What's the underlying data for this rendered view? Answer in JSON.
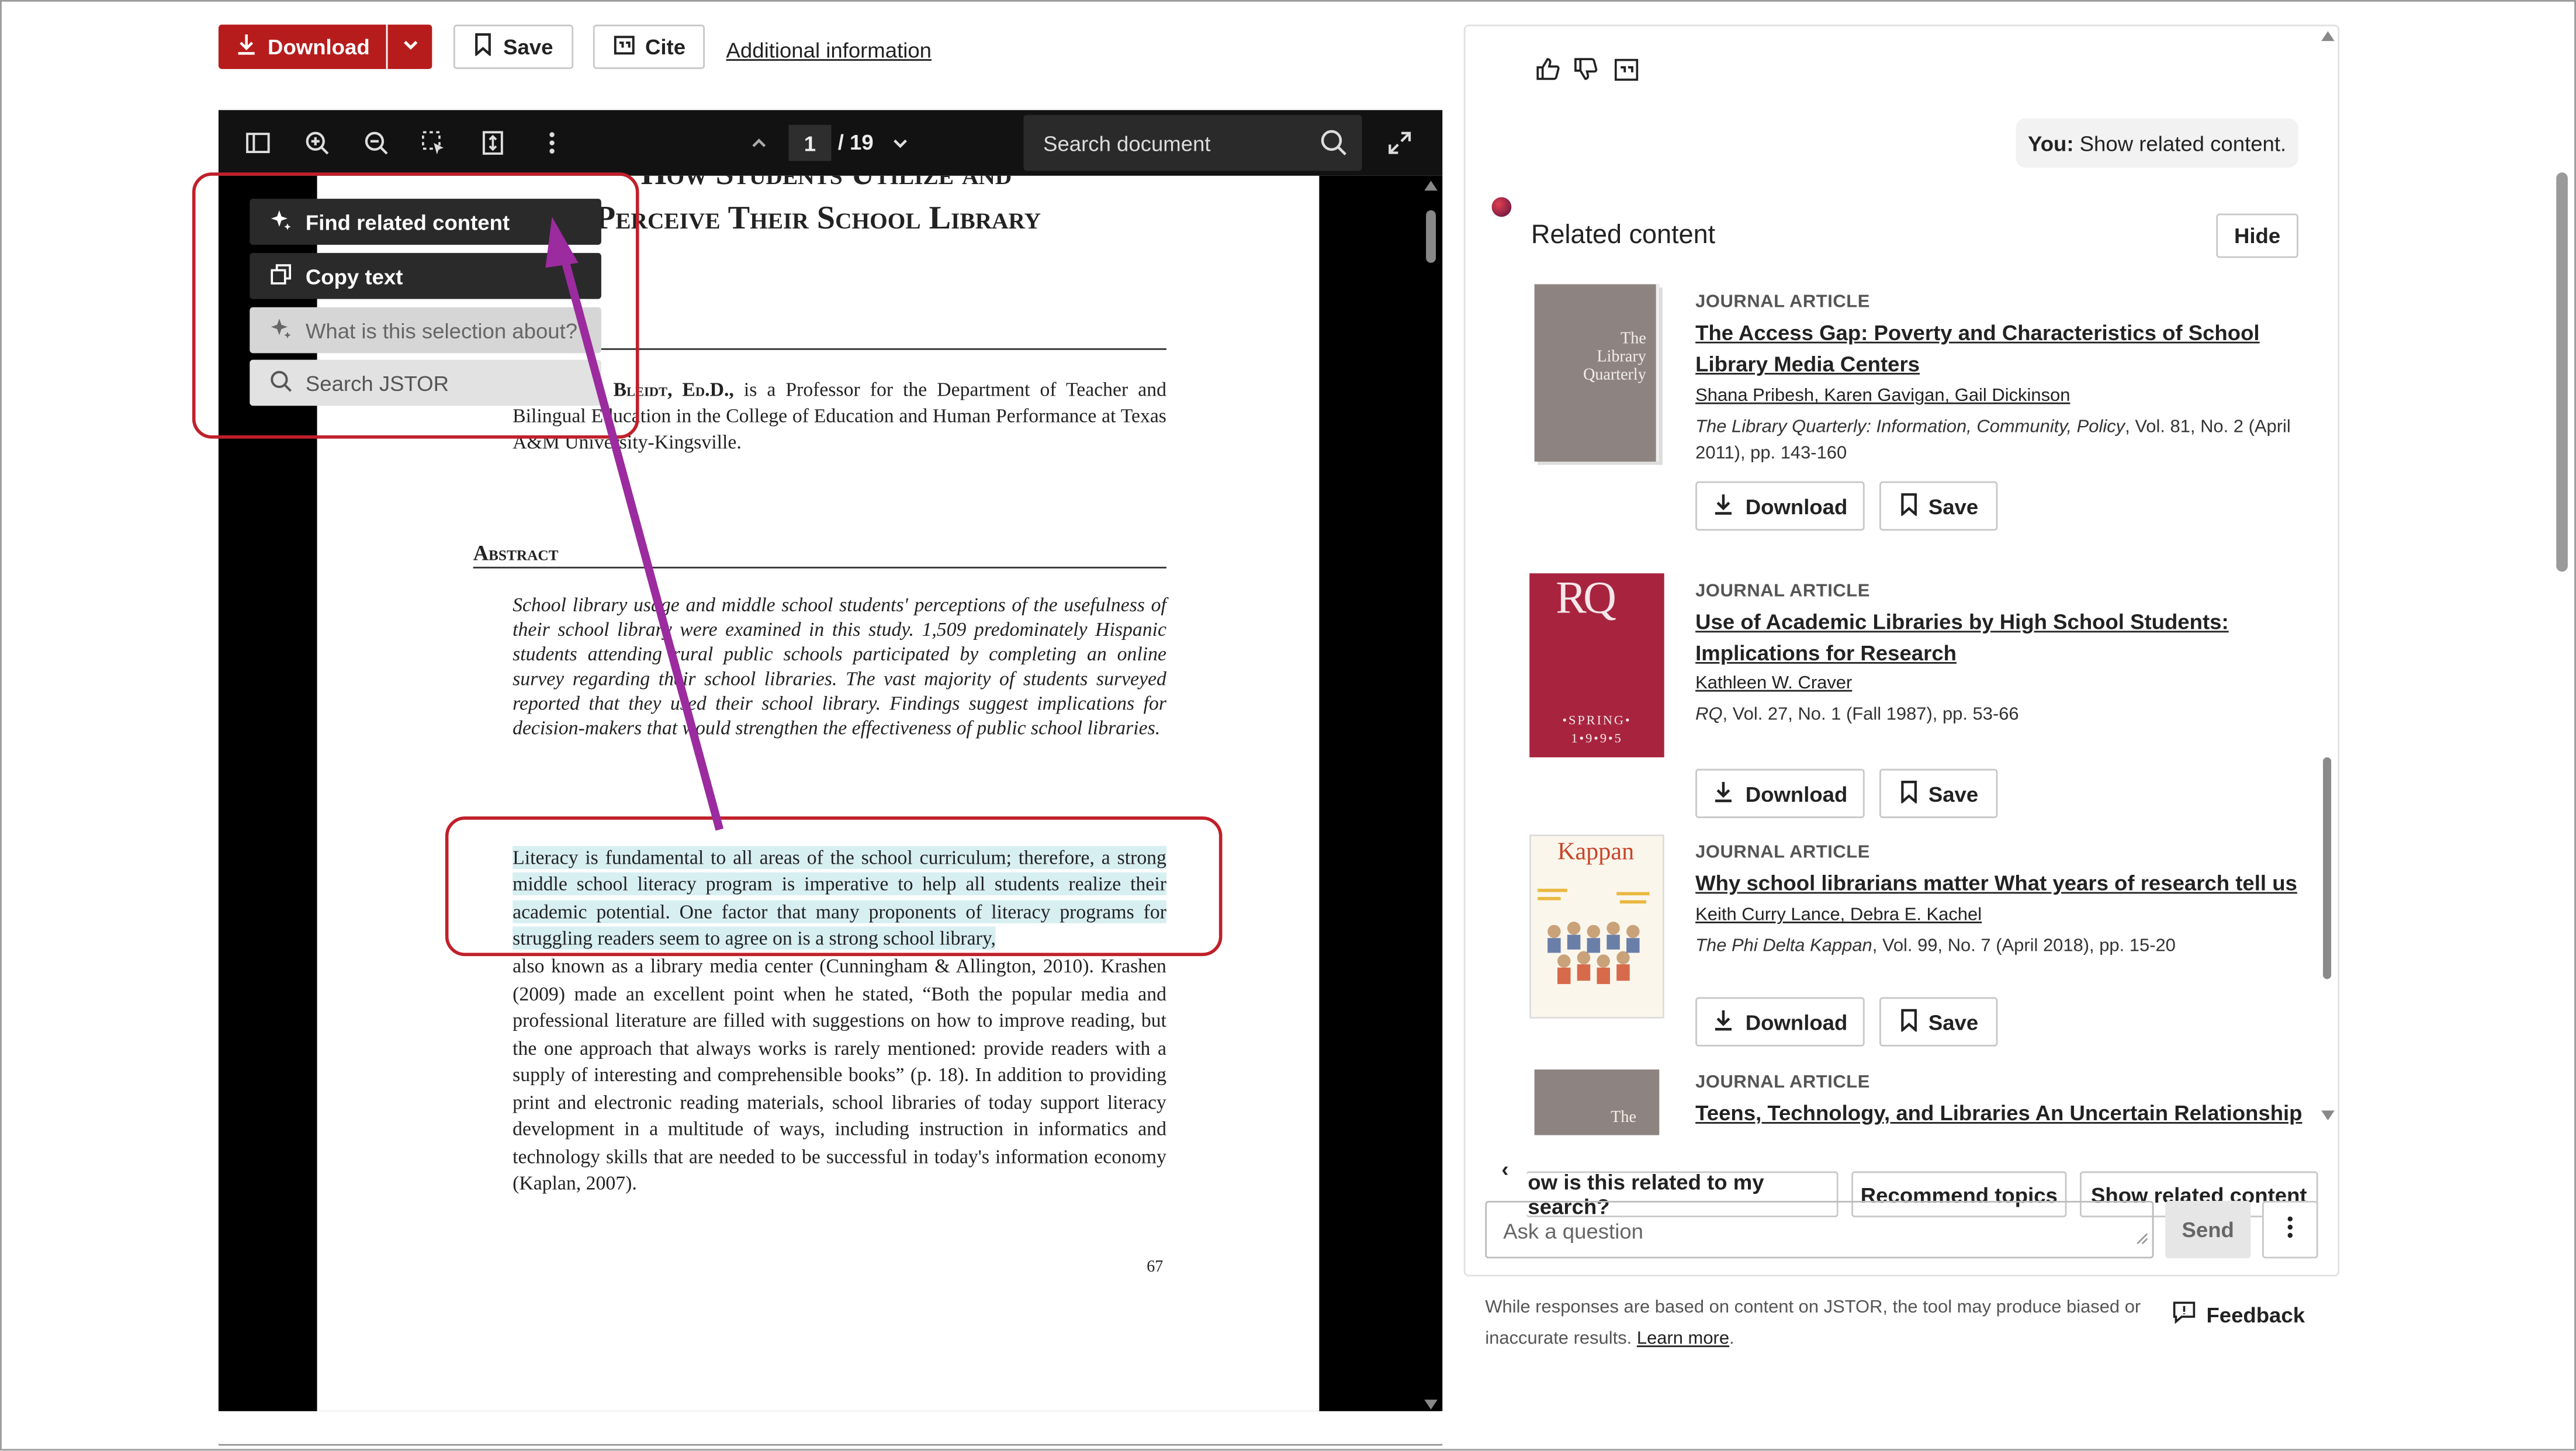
{
  "top_bar": {
    "download": "Download",
    "save": "Save",
    "cite": "Cite",
    "additional": "Additional information"
  },
  "viewer": {
    "page_current": "1",
    "page_total": "/ 19",
    "search_placeholder": "Search document"
  },
  "context_menu": {
    "find_related": "Find related content",
    "copy_text": "Copy text",
    "what_is": "What is this selection about?",
    "search_jstor": "Search JSTOR"
  },
  "page": {
    "title_top": "How Students Utilize and",
    "title": "Perceive Their School Library",
    "author_bold": "Shirley A. Bleidt, Ed.D.,",
    "author_rest": " is a Professor for the Department of Teacher and Bilingual Education in the College of Education and Human Performance at Texas A&M University-Kingsville.",
    "abstract_heading": "Abstract",
    "abstract": "School library usage and middle school students' perceptions of the usefulness of their school library were examined in this study. 1,509 predominately Hispanic students attending rural public schools participated by completing an online survey regarding their school libraries. The vast majority of students surveyed reported that they used their school library. Findings suggest implications for decision-makers that would strengthen the effectiveness of public school libraries.",
    "body_1": "Literacy is fundamental to all areas of the school curriculum; therefore, a strong middle school literacy program is imperative to help all students realize their academic potential. One factor that many proponents of literacy programs for struggling readers seem to agree on is a strong school library,",
    "body_2": "also known as a library media center (Cunningham & Allington, 2010). Krashen (2009) made an excellent point when he stated, “Both the popular media and professional literature are filled with suggestions on how to improve reading, but the one approach that always works is rarely mentioned: provide readers with a supply of interesting and comprehensible books” (p. 18). In addition to providing print and electronic reading materials, school libraries of today support literacy development in a multitude of ways, including instruction in informatics and technology skills that are needed to be successful in today's information economy (Kaplan, 2007).",
    "page_number": "67"
  },
  "panel": {
    "user_message_prefix": "You:",
    "user_message": " Show related content.",
    "related_heading": "Related content",
    "hide": "Hide",
    "articles": [
      {
        "type": "JOURNAL ARTICLE",
        "title": "The Access Gap: Poverty and Characteristics of School Library Media Centers",
        "authors": [
          "Shana Pribesh",
          "Karen Gavigan",
          "Gail Dickinson"
        ],
        "source_journal": "The Library Quarterly: Information, Community, Policy",
        "source_rest": ", Vol. 81, No. 2 (April 2011), pp. 143-160",
        "download": "Download",
        "save": "Save",
        "cover_text": "The Library Quarterly"
      },
      {
        "type": "JOURNAL ARTICLE",
        "title": "Use of Academic Libraries by High School Students: Implications for Research",
        "authors": [
          "Kathleen W. Craver"
        ],
        "source_journal": "RQ",
        "source_rest": ", Vol. 27, No. 1 (Fall 1987), pp. 53-66",
        "download": "Download",
        "save": "Save",
        "cover_text": "RQ",
        "cover_sub": "•SPRING• 1•9•9•5"
      },
      {
        "type": "JOURNAL ARTICLE",
        "title": "Why school librarians matter What years of research tell us",
        "authors": [
          "Keith Curry Lance",
          "Debra E. Kachel"
        ],
        "source_journal": "The Phi Delta Kappan",
        "source_rest": ", Vol. 99, No. 7 (April 2018), pp. 15-20",
        "download": "Download",
        "save": "Save",
        "cover_text": "Kappan"
      },
      {
        "type": "JOURNAL ARTICLE",
        "title": "Teens, Technology, and Libraries An Uncertain Relationship",
        "cover_text": "The"
      }
    ],
    "chips": [
      "ow is this related to my search?",
      "Recommend topics",
      "Show related content"
    ],
    "ask_placeholder": "Ask a question",
    "send": "Send",
    "disclaimer": "While responses are based on content on JSTOR, the tool may produce biased or inaccurate results.",
    "learn_more": "Learn more",
    "feedback": "Feedback"
  },
  "colors": {
    "accent_red": "#b71c1c",
    "annotation_red": "#c0202a",
    "arrow_purple": "#9b2b9e",
    "highlight": "#d8eff2"
  }
}
